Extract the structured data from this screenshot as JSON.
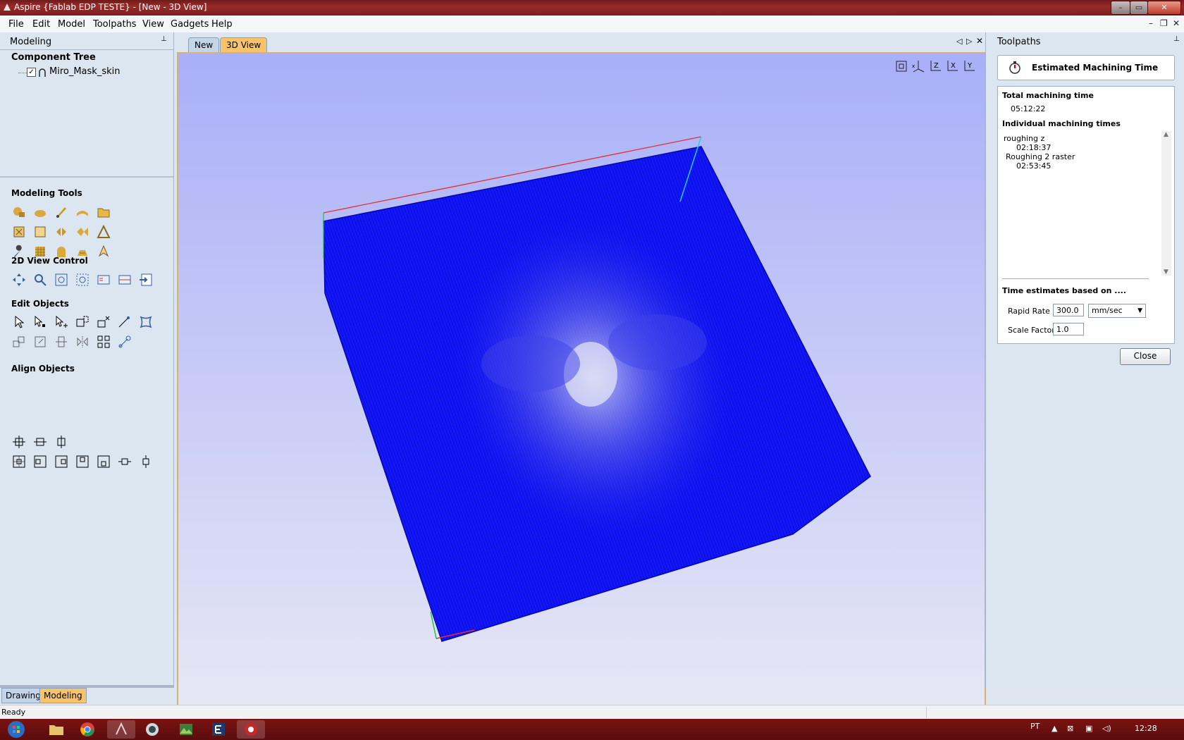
{
  "window": {
    "title": "Aspire {Fablab EDP TESTE} - [New - 3D View]",
    "controls": {
      "minimize": "–",
      "maximize": "▭",
      "close": "✕"
    }
  },
  "menu": {
    "items": [
      "File",
      "Edit",
      "Model",
      "Toolpaths",
      "View",
      "Gadgets",
      "Help"
    ],
    "mdi": {
      "minimize": "–",
      "restore": "❐",
      "close": "✕"
    }
  },
  "left_panel": {
    "header": "Modeling",
    "pin": "📌",
    "component_tree": {
      "title": "Component Tree",
      "items": [
        {
          "label": "Miro_Mask_skin",
          "checked": true
        }
      ]
    },
    "sections": {
      "modeling_tools": "Modeling Tools",
      "view_control": "2D View Control",
      "edit_objects": "Edit Objects",
      "align_objects": "Align Objects"
    },
    "bottom_tabs": [
      "Drawing",
      "Modeling"
    ]
  },
  "doc_tabs": [
    "New",
    "3D View"
  ],
  "doc_nav": {
    "prev": "◁",
    "next": "▷",
    "close": "✕"
  },
  "view_icons": [
    "fit-view-icon",
    "iso-view-icon",
    "z-view-icon",
    "x-view-icon",
    "y-view-icon"
  ],
  "right_panel": {
    "header": "Toolpaths",
    "pin": "📌",
    "dialog_title": "Estimated Machining Time",
    "total_label": "Total machining time",
    "total_value": "05:12:22",
    "individual_label": "Individual  machining times",
    "individual_items": [
      {
        "name": "roughing z",
        "time": "02:18:37"
      },
      {
        "name": "Roughing 2 raster",
        "time": "02:53:45"
      }
    ],
    "estimates_label": "Time estimates based on ....",
    "rapid_rate_label": "Rapid Rate",
    "rapid_rate_value": "300.0",
    "rapid_rate_unit": "mm/sec",
    "scale_factor_label": "Scale Factor",
    "scale_factor_value": "1.0",
    "close_label": "Close"
  },
  "status": {
    "text": "Ready"
  },
  "taskbar": {
    "lang": "PT",
    "clock": "12:28"
  },
  "colors": {
    "toolpath": "#0b0ff2",
    "accent_tab": "#f7c46b",
    "titlebar": "#8a2222"
  }
}
